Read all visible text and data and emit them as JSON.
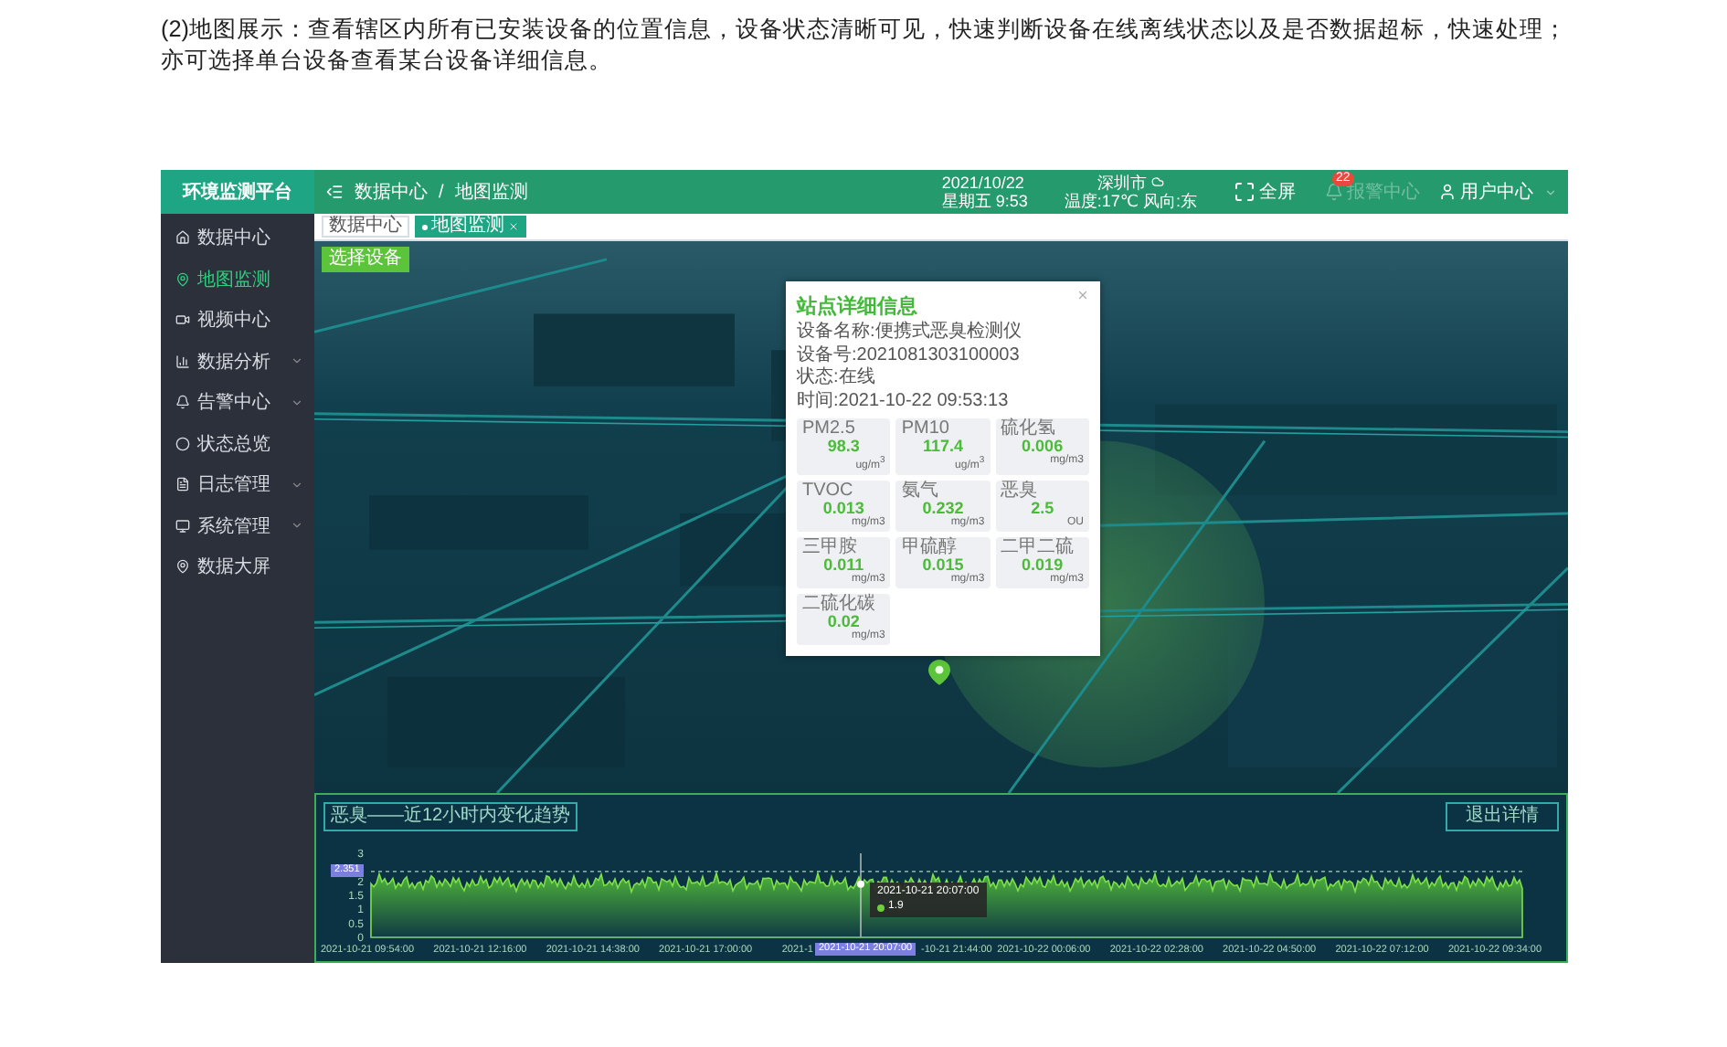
{
  "intro": "(2)地图展示：查看辖区内所有已安装设备的位置信息，设备状态清晰可见，快速判断设备在线离线状态以及是否数据超标，快速处理；亦可选择单台设备查看某台设备详细信息。",
  "app": {
    "title": "环境监测平台",
    "breadcrumb": [
      "数据中心",
      "/",
      "地图监测"
    ],
    "header": {
      "date": "2021/10/22",
      "weekday_time": "星期五 9:53",
      "city": "深圳市",
      "weather": "温度:17℃ 风向:东",
      "fullscreen": "全屏",
      "alarm_count": "22",
      "alarm": "报警中心",
      "user": "用户中心"
    },
    "sidebar": [
      {
        "label": "数据中心",
        "selected": false,
        "expandable": false
      },
      {
        "label": "地图监测",
        "selected": true,
        "expandable": false
      },
      {
        "label": "视频中心",
        "selected": false,
        "expandable": false
      },
      {
        "label": "数据分析",
        "selected": false,
        "expandable": true
      },
      {
        "label": "告警中心",
        "selected": false,
        "expandable": true
      },
      {
        "label": "状态总览",
        "selected": false,
        "expandable": false
      },
      {
        "label": "日志管理",
        "selected": false,
        "expandable": true
      },
      {
        "label": "系统管理",
        "selected": false,
        "expandable": true
      },
      {
        "label": "数据大屏",
        "selected": false,
        "expandable": false
      }
    ],
    "tabs": [
      {
        "label": "数据中心",
        "selected": false,
        "closable": false
      },
      {
        "label": "地图监测",
        "selected": true,
        "closable": true
      }
    ],
    "map": {
      "button": "选择设备",
      "popup": {
        "title": "站点详细信息",
        "info": [
          "设备名称:便携式恶臭检测仪",
          "设备号:2021081303100003",
          "状态:在线",
          "时间:2021-10-22 09:53:13"
        ],
        "readings": [
          {
            "name": "PM2.5",
            "value": "98.3",
            "unit": "ug/m$^{3}$"
          },
          {
            "name": "PM10",
            "value": "117.4",
            "unit": "ug/m$^{3}$"
          },
          {
            "name": "硫化氢",
            "value": "0.006",
            "unit": "mg/m3"
          },
          {
            "name": "TVOC",
            "value": "0.013",
            "unit": "mg/m3"
          },
          {
            "name": "氨气",
            "value": "0.232",
            "unit": "mg/m3"
          },
          {
            "name": "恶臭",
            "value": "2.5",
            "unit": "OU"
          },
          {
            "name": "三甲胺",
            "value": "0.011",
            "unit": "mg/m3"
          },
          {
            "name": "甲硫醇",
            "value": "0.015",
            "unit": "mg/m3"
          },
          {
            "name": "二甲二硫",
            "value": "0.019",
            "unit": "mg/m3"
          },
          {
            "name": "二硫化碳",
            "value": "0.02",
            "unit": "mg/m3"
          }
        ]
      }
    },
    "trend": {
      "title": "恶臭——近12小时内变化趋势",
      "exit": "退出详情",
      "yticks": [
        "3",
        "2",
        "1.5",
        "1",
        "0.5",
        "0"
      ],
      "xlabels": [
        "2021-10-21 09:54:00",
        "2021-10-21 12:16:00",
        "2021-10-21 14:38:00",
        "2021-10-21 17:00:00",
        "2021-1",
        "-10-21 21:44:00",
        "2021-10-22 00:06:00",
        "2021-10-22 02:28:00",
        "2021-10-22 04:50:00",
        "2021-10-22 07:12:00",
        "2021-10-22 09:34:00"
      ],
      "pointer_value": "2.351",
      "pointer_time": "2021-10-21 20:07:00",
      "tooltip": {
        "time": "2021-10-21 20:07:00",
        "value": "1.9"
      }
    }
  }
}
